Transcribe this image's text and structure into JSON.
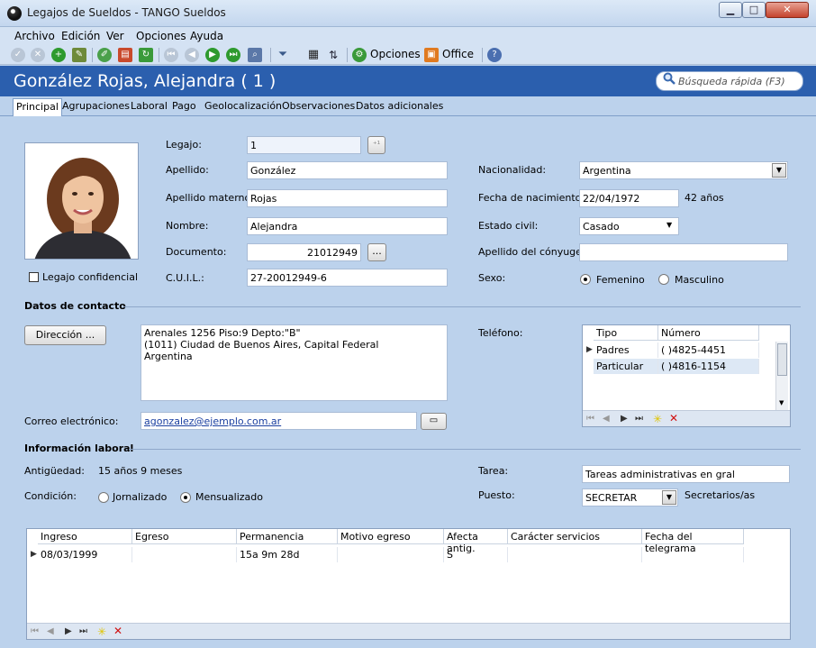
{
  "window": {
    "title": "Legajos de Sueldos - TANGO Sueldos",
    "min": "▁",
    "max": "□",
    "close": "✕"
  },
  "menu": [
    "Archivo",
    "Edición",
    "Ver",
    "Opciones",
    "Ayuda"
  ],
  "toolbar": {
    "options_label": "Opciones",
    "office_label": "Office"
  },
  "header": {
    "title": "González Rojas, Alejandra ( 1 )",
    "search_placeholder": "Búsqueda rápida (F3)"
  },
  "tabs": [
    "Principal",
    "Agrupaciones",
    "Laboral",
    "Pago",
    "Geolocalización",
    "Observaciones",
    "Datos adicionales"
  ],
  "personal": {
    "legajo_label": "Legajo:",
    "legajo": "1",
    "apellido_label": "Apellido:",
    "apellido": "González",
    "apellido_materno_label": "Apellido materno:",
    "apellido_materno": "Rojas",
    "nombre_label": "Nombre:",
    "nombre": "Alejandra",
    "documento_label": "Documento:",
    "documento": "21012949",
    "cuil_label": "C.U.I.L.:",
    "cuil": "27-20012949-6",
    "confidencial_label": "Legajo confidencial",
    "nacionalidad_label": "Nacionalidad:",
    "nacionalidad": "Argentina",
    "fecha_nac_label": "Fecha de nacimiento:",
    "fecha_nac": "22/04/1972",
    "edad": "42 años",
    "estado_civil_label": "Estado civil:",
    "estado_civil": "Casado",
    "apellido_conyuge_label": "Apellido del cónyuge:",
    "apellido_conyuge": "",
    "sexo_label": "Sexo:",
    "sexo_f": "Femenino",
    "sexo_m": "Masculino"
  },
  "contacto": {
    "section": "Datos de contacto",
    "direccion_button": "Dirección ...",
    "direccion_lines": [
      "Arenales 1256 Piso:9 Depto:\"B\"",
      "(1011) Ciudad de Buenos Aires, Capital Federal",
      "Argentina"
    ],
    "telefono_label": "Teléfono:",
    "telefono_headers": [
      "Tipo",
      "Número"
    ],
    "telefonos": [
      [
        "Padres",
        "(    )4825-4451"
      ],
      [
        "Particular",
        "(    )4816-1154"
      ]
    ],
    "correo_label": "Correo electrónico:",
    "correo": "agonzalez@ejemplo.com.ar"
  },
  "laboral": {
    "section": "Información laboral",
    "antiguedad_label": "Antigüedad:",
    "antiguedad": "15 años 9 meses",
    "condicion_label": "Condición:",
    "jornalizado": "Jornalizado",
    "mensualizado": "Mensualizado",
    "tarea_label": "Tarea:",
    "tarea": "Tareas administrativas en gral",
    "puesto_label": "Puesto:",
    "puesto": "SECRETAR",
    "puesto_desc": "Secretarios/as",
    "headers": [
      "Ingreso",
      "Egreso",
      "Permanencia",
      "Motivo egreso",
      "Afecta antig.",
      "Carácter servicios",
      "Fecha del telegrama"
    ],
    "rows": [
      [
        "08/03/1999",
        "",
        "15a 9m 28d",
        "",
        "S",
        "",
        ""
      ]
    ]
  }
}
